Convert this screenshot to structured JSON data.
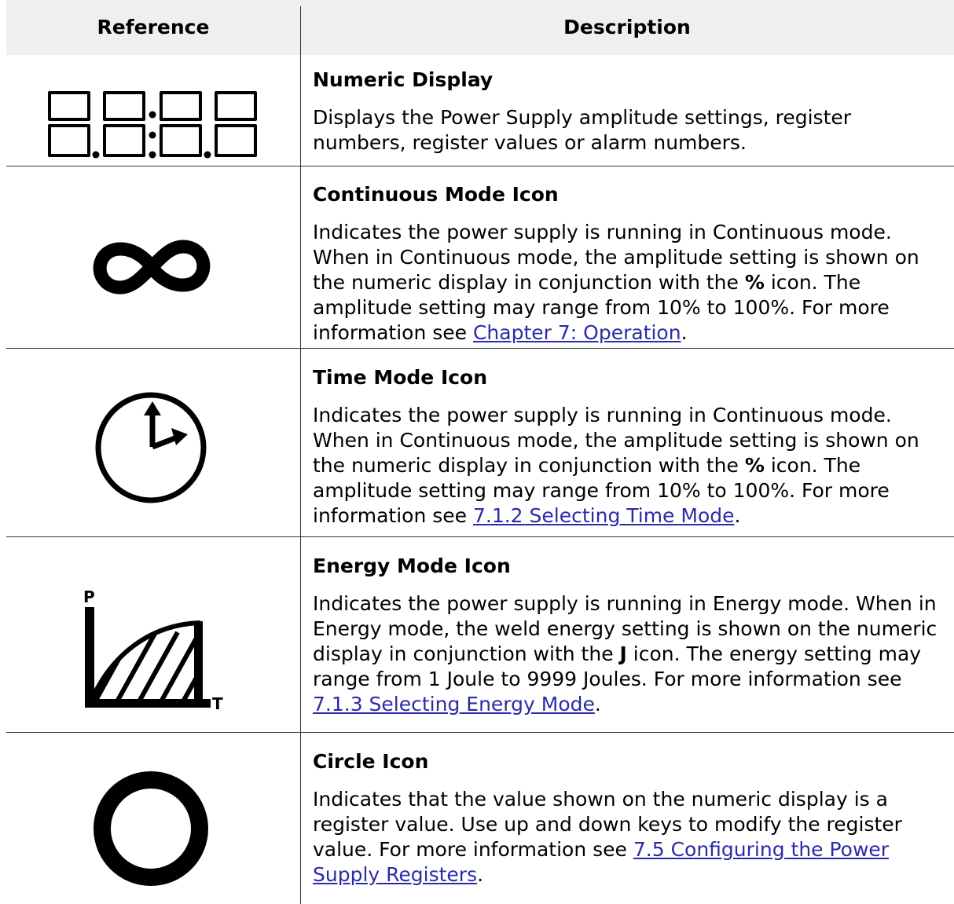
{
  "header": {
    "reference": "Reference",
    "description": "Description"
  },
  "rows": [
    {
      "icon": "seven-segment-display-icon",
      "title": "Numeric Display",
      "text": "Displays the Power Supply amplitude settings, register numbers, register values or alarm numbers."
    },
    {
      "icon": "infinity-icon",
      "title": "Continuous Mode Icon",
      "text_before": "Indicates the power supply is running in Continuous mode. When in Continuous mode, the amplitude setting is shown on the numeric display in conjunction with the ",
      "bold": "%",
      "text_middle": " icon. The amplitude setting may range from 10% to 100%. For more information see ",
      "link": "Chapter 7: Operation",
      "text_after": "."
    },
    {
      "icon": "clock-icon",
      "title": "Time Mode Icon",
      "text_before": "Indicates the power supply is running in Continuous mode. When in Continuous mode, the amplitude setting is shown on the numeric display in conjunction with the ",
      "bold": "%",
      "text_middle": " icon. The amplitude setting may range from 10% to 100%. For more information see ",
      "link": "7.1.2 Selecting Time Mode",
      "text_after": "."
    },
    {
      "icon": "energy-graph-icon",
      "icon_labels": {
        "p": "P",
        "t": "T"
      },
      "title": "Energy Mode Icon",
      "text_before": "Indicates the power supply is running in Energy mode. When in Energy mode, the weld energy setting is shown on the numeric display in conjunction with the ",
      "bold": "J",
      "text_middle": " icon. The energy setting may range from 1 Joule to 9999 Joules. For more information see ",
      "link": "7.1.3 Selecting Energy Mode",
      "text_after": "."
    },
    {
      "icon": "circle-icon",
      "title": "Circle Icon",
      "text_before": "Indicates that the value shown on the numeric display is a register value. Use up and down keys to modify the register value. For more information see ",
      "link": "7.5 Configuring the Power Supply Registers",
      "text_after": "."
    }
  ]
}
